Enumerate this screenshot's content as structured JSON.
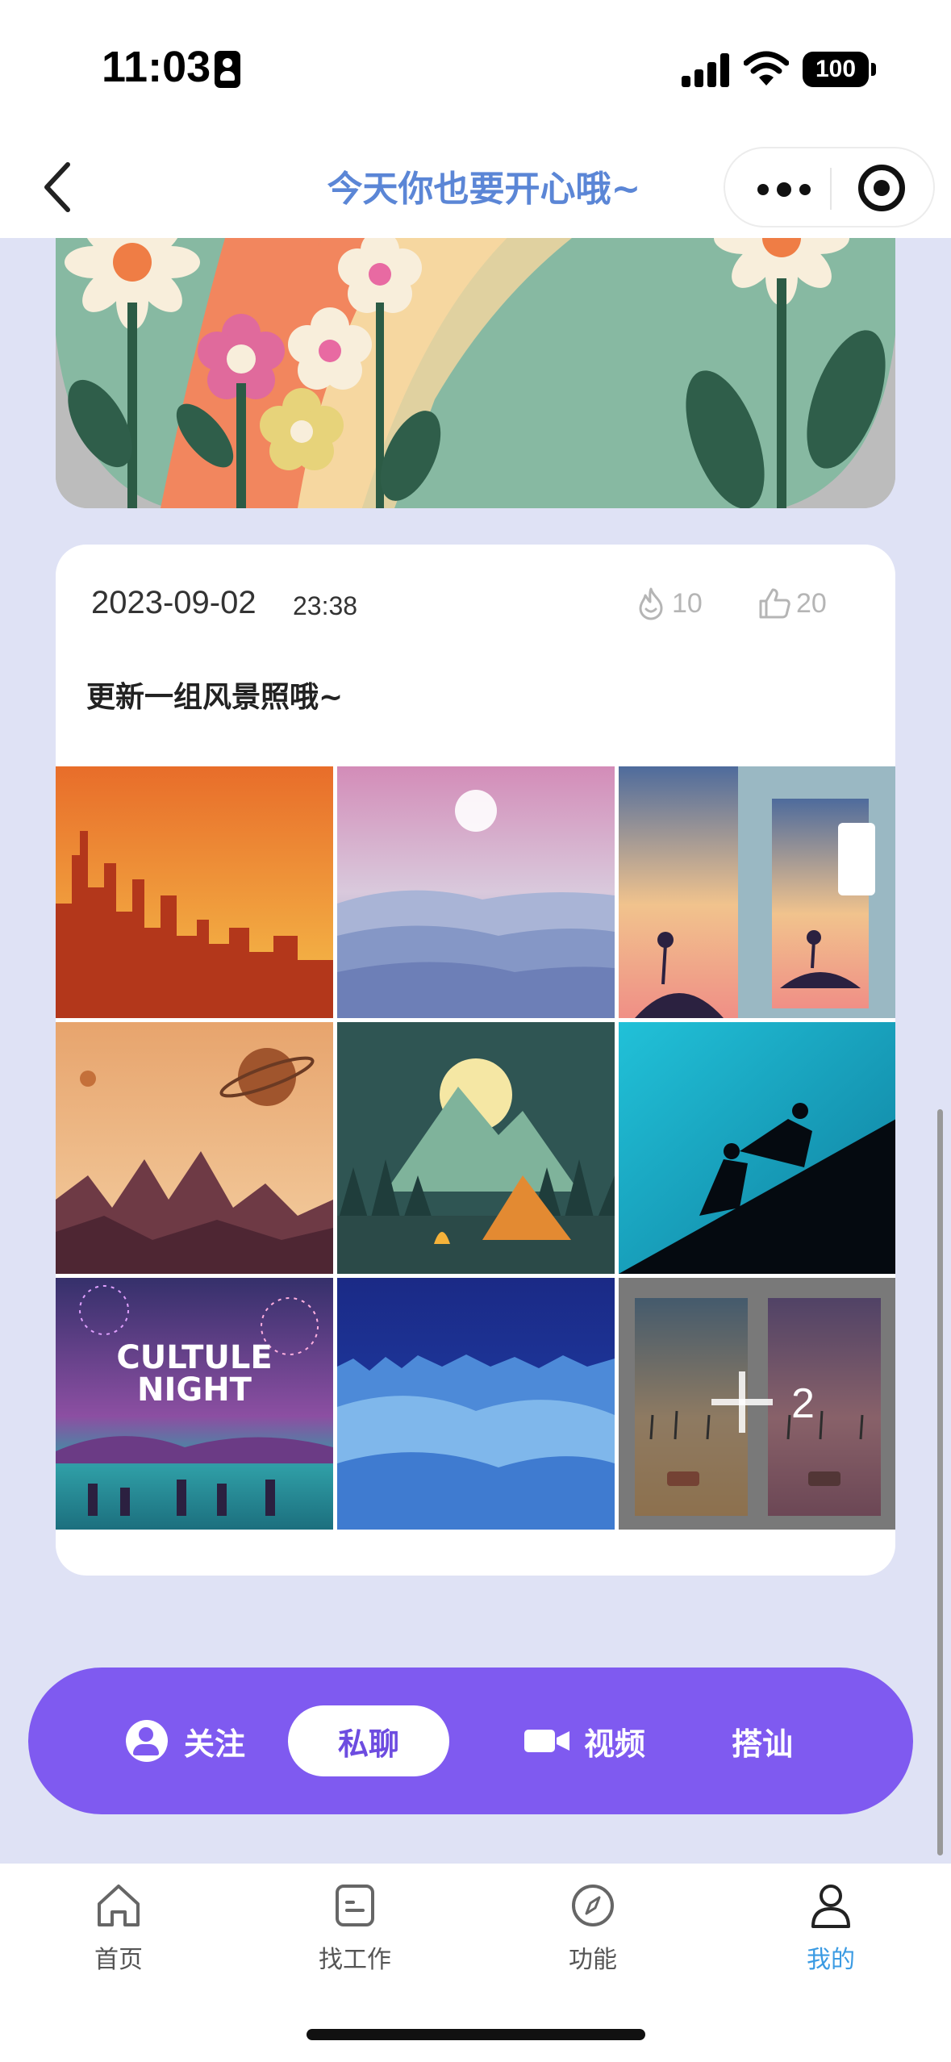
{
  "status_bar": {
    "time": "11:03",
    "battery": "100",
    "icons": [
      "id-card-icon",
      "signal-icon",
      "wifi-icon",
      "battery-icon"
    ]
  },
  "nav": {
    "title": "今天你也要开心哦~",
    "title_color": "#5b86d6",
    "back_icon": "chevron-left-icon",
    "capsule_icons": [
      "more-dots-icon",
      "target-icon"
    ]
  },
  "post": {
    "date": "2023-09-02",
    "time": "23:38",
    "views": "10",
    "likes": "20",
    "views_icon": "flame-icon",
    "likes_icon": "thumbs-up-icon",
    "text": "更新一组风景照哦~",
    "photos": [
      "sunset-city-skyline",
      "misty-mountains-sun",
      "palm-island-phone-mockup",
      "planet-desert-rocks",
      "tent-campfire-mountain",
      "climbers-helping-silhouette",
      "cultule-night-fireworks",
      "starry-forest-reflection",
      "beach-palms-car-mockup"
    ],
    "poster_text": "CULTULE NIGHT",
    "more_count": "2"
  },
  "actions": {
    "follow": "关注",
    "message": "私聊",
    "video": "视频",
    "chat_up": "搭讪",
    "bar_color": "#7f5af0"
  },
  "tabs": [
    {
      "label": "首页",
      "icon": "home-icon",
      "active": false
    },
    {
      "label": "找工作",
      "icon": "job-icon",
      "active": false
    },
    {
      "label": "功能",
      "icon": "compass-icon",
      "active": false
    },
    {
      "label": "我的",
      "icon": "user-icon",
      "active": true
    }
  ],
  "colors": {
    "page_background": "#dfe2f5",
    "active_tab": "#3b9be3"
  }
}
